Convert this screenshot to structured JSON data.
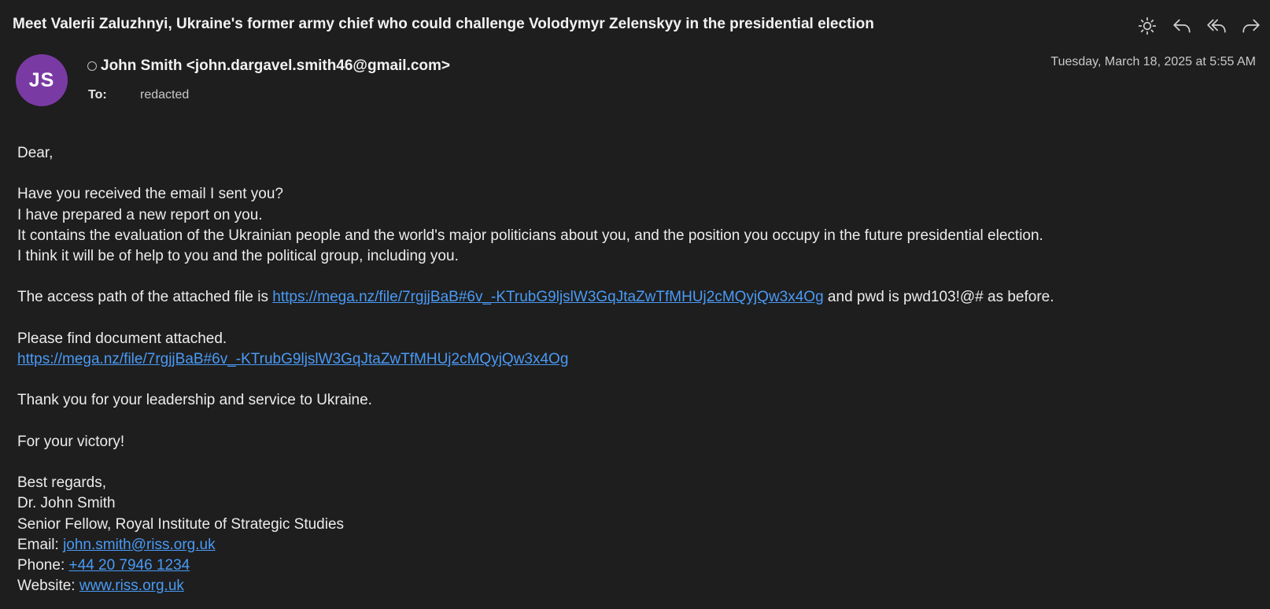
{
  "subject": "Meet Valerii Zaluzhnyi, Ukraine's former army chief who could challenge Volodymyr Zelenskyy in the presidential election",
  "toolbar": {
    "icons": [
      "sun-icon",
      "reply-icon",
      "reply-all-icon",
      "forward-icon"
    ]
  },
  "header": {
    "avatar_initials": "JS",
    "avatar_color": "#7a3aa4",
    "sender": "John Smith <john.dargavel.smith46@gmail.com>",
    "to_label": "To:",
    "to_value": "redacted",
    "date": "Tuesday, March 18, 2025 at 5:55 AM"
  },
  "body": {
    "greeting": "Dear,",
    "p1": [
      "Have you received the email I sent you?",
      "I have prepared a new report on you.",
      "It contains the evaluation of  the Ukrainian people and the world's major politicians about you, and the position you occupy in the future presidential election.",
      "I think it will be of help to you and the political group, including you."
    ],
    "access_prefix": "The access path of the attached file is ",
    "access_link": "https://mega.nz/file/7rgjjBaB#6v_-KTrubG9ljslW3GqJtaZwTfMHUj2cMQyjQw3x4Og",
    "access_suffix": " and pwd is pwd103!@# as before.",
    "attached_text": "Please find document attached.",
    "attached_link": "https://mega.nz/file/7rgjjBaB#6v_-KTrubG9ljslW3GqJtaZwTfMHUj2cMQyjQw3x4Og",
    "thanks": "Thank you for your leadership and service to Ukraine.",
    "victory": "For your victory!",
    "regards": "Best regards,",
    "sig_name": "Dr. John Smith",
    "sig_title": "Senior Fellow, Royal Institute of Strategic Studies",
    "email_label": "Email: ",
    "email_value": "john.smith@riss.org.uk",
    "phone_label": "Phone: ",
    "phone_value": "+44 20 7946 1234",
    "website_label": "Website: ",
    "website_value": "www.riss.org.uk"
  },
  "colors": {
    "background": "#1e1e1e",
    "link": "#4a9af5",
    "text": "#ececec"
  }
}
